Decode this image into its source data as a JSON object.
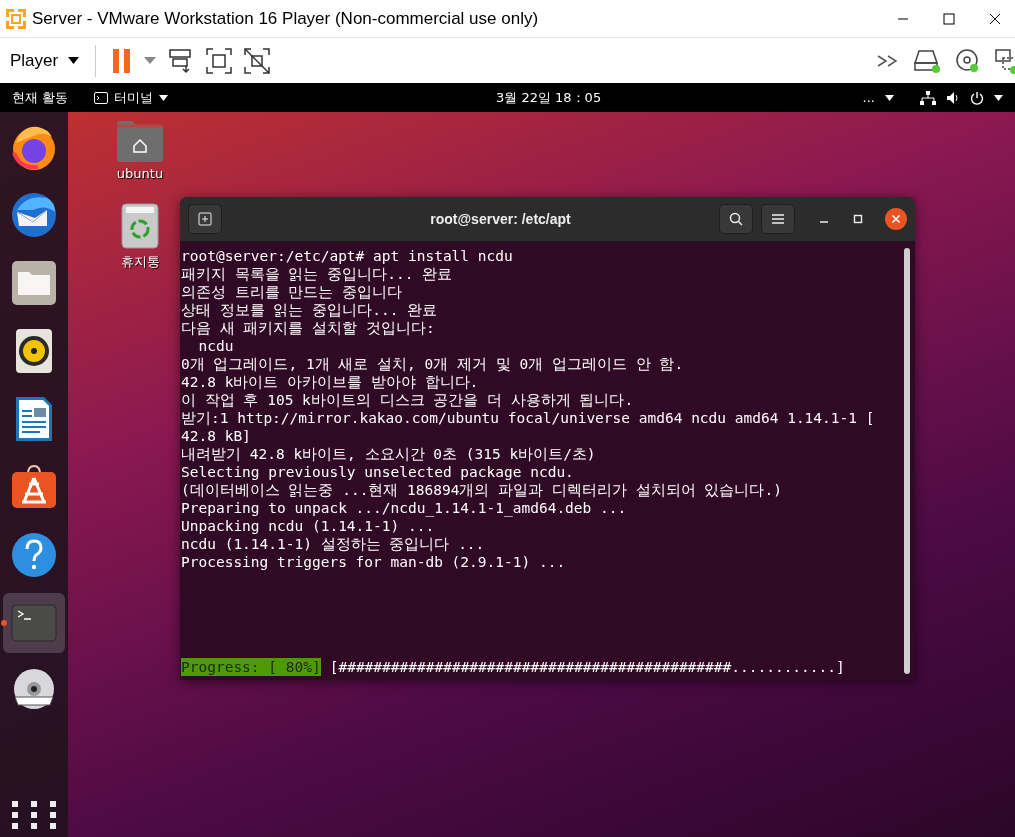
{
  "window": {
    "title": "Server - VMware Workstation 16 Player (Non-commercial use only)"
  },
  "toolbar": {
    "player_menu": "Player",
    "paused": true
  },
  "topbar": {
    "activities": "현재 활동",
    "app_menu": "터미널",
    "clock": "3월 22일  18：05",
    "overflow": "..."
  },
  "dock": {
    "items": [
      {
        "kind": "firefox",
        "running": false,
        "selected": false
      },
      {
        "kind": "thunderbird",
        "running": false,
        "selected": false
      },
      {
        "kind": "files",
        "running": false,
        "selected": false
      },
      {
        "kind": "rhythmbox",
        "running": false,
        "selected": false
      },
      {
        "kind": "writer",
        "running": false,
        "selected": false
      },
      {
        "kind": "software",
        "running": false,
        "selected": false
      },
      {
        "kind": "help",
        "running": false,
        "selected": false
      },
      {
        "kind": "terminal",
        "running": true,
        "selected": true
      },
      {
        "kind": "dvd",
        "running": false,
        "selected": false
      }
    ]
  },
  "desktop_icons": [
    {
      "kind": "home",
      "label": "ubuntu"
    },
    {
      "kind": "trash",
      "label": "휴지통"
    }
  ],
  "terminal": {
    "title": "root@server: /etc/apt",
    "lines": [
      "root@server:/etc/apt# apt install ncdu",
      "패키지 목록을 읽는 중입니다... 완료",
      "의존성 트리를 만드는 중입니다",
      "상태 정보를 읽는 중입니다... 완료",
      "다음 새 패키지를 설치할 것입니다:",
      "  ncdu",
      "0개 업그레이드, 1개 새로 설치, 0개 제거 및 0개 업그레이드 안 함.",
      "42.8 k바이트 아카이브를 받아야 합니다.",
      "이 작업 후 105 k바이트의 디스크 공간을 더 사용하게 됩니다.",
      "받기:1 http://mirror.kakao.com/ubuntu focal/universe amd64 ncdu amd64 1.14.1-1 [",
      "42.8 kB]",
      "내려받기 42.8 k바이트, 소요시간 0초 (315 k바이트/초)",
      "Selecting previously unselected package ncdu.",
      "(데이터베이스 읽는중 ...현재 186894개의 파일과 디렉터리가 설치되어 있습니다.)",
      "Preparing to unpack .../ncdu_1.14.1-1_amd64.deb ...",
      "Unpacking ncdu (1.14.1-1) ...",
      "ncdu (1.14.1-1) 설정하는 중입니다 ...",
      "Processing triggers for man-db (2.9.1-1) ..."
    ],
    "progress": {
      "label": "Progress: [ 80%]",
      "bar": "[#############################################............]"
    }
  }
}
